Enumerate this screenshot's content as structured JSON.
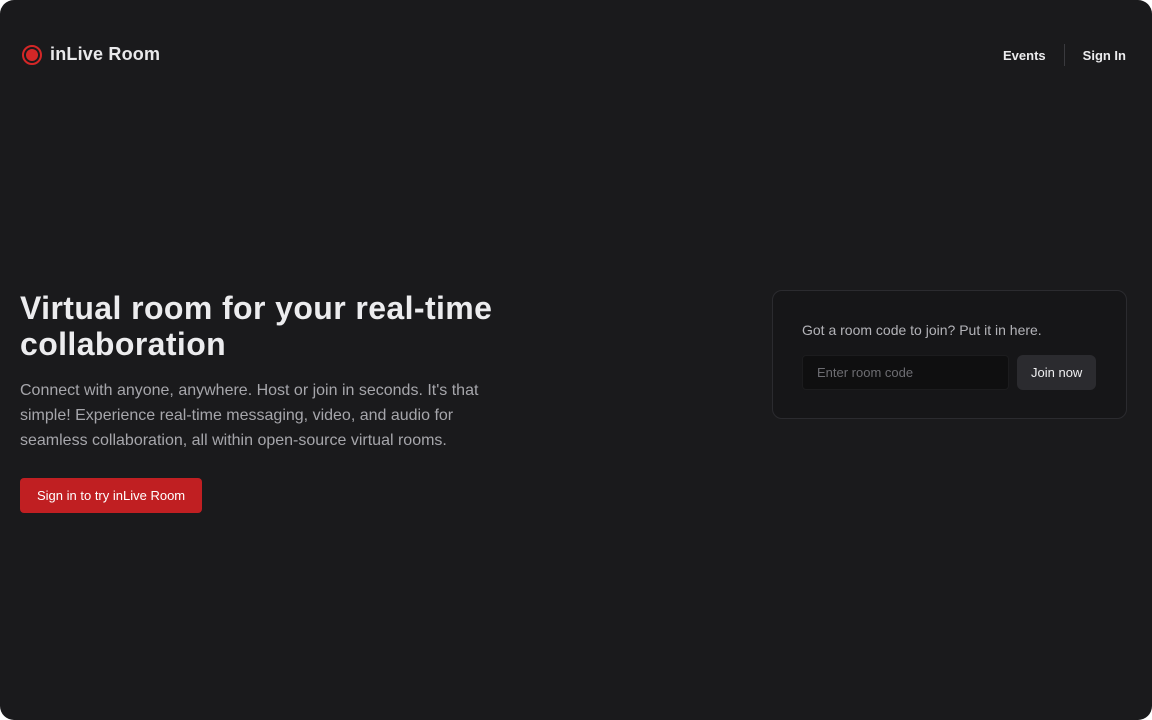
{
  "header": {
    "brand_name": "inLive Room",
    "brand_icon": "record-icon",
    "brand_color": "#d42727",
    "nav": {
      "events_label": "Events",
      "sign_in_label": "Sign In"
    }
  },
  "hero": {
    "title": "Virtual room for your real-time collaboration",
    "description": "Connect with anyone, anywhere. Host or join in seconds. It's that simple! Experience real-time messaging, video, and audio for seamless collaboration, all within open-source virtual rooms.",
    "cta_label": "Sign in to try inLive Room",
    "cta_color": "#c01f22"
  },
  "join_card": {
    "prompt": "Got a room code to join? Put it in here.",
    "input_placeholder": "Enter room code",
    "input_value": "",
    "join_label": "Join now"
  },
  "theme": {
    "background": "#1a1a1c",
    "card_background": "#161618"
  }
}
